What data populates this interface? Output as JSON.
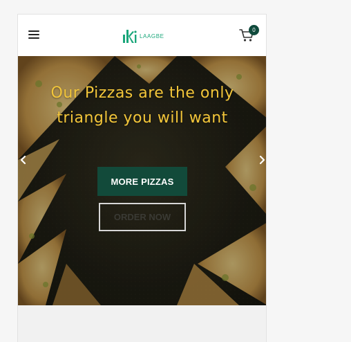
{
  "header": {
    "logo_text": "LAAGBE",
    "cart_count": "0",
    "menu_icon": "hamburger-icon",
    "cart_icon": "cart-icon"
  },
  "hero": {
    "headline": "Our Pizzas are the only triangle you will want",
    "primary_button": "MORE PIZZAS",
    "secondary_button": "ORDER NOW",
    "prev_icon": "chevron-left-icon",
    "next_icon": "chevron-right-icon"
  },
  "colors": {
    "accent": "#124a3a",
    "headline": "#f3c63a",
    "logo": "#1aa67a"
  }
}
